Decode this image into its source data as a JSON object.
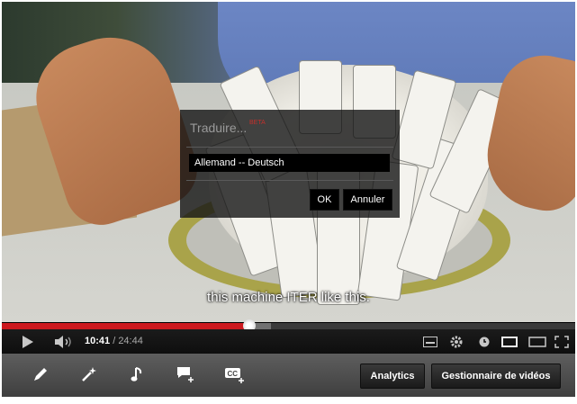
{
  "video": {
    "caption": "this machine ITER like this."
  },
  "translate_dialog": {
    "title": "Traduire...",
    "beta": "BETA",
    "language": "Allemand -- Deutsch",
    "ok_label": "OK",
    "cancel_label": "Annuler"
  },
  "player": {
    "current_time": "10:41",
    "duration": "/ 24:44",
    "progress": 0.432,
    "buffered": 0.47
  },
  "editor": {
    "analytics_label": "Analytics",
    "manager_label": "Gestionnaire de vidéos"
  },
  "colors": {
    "progress": "#cc181e",
    "beta": "#c4302b"
  }
}
